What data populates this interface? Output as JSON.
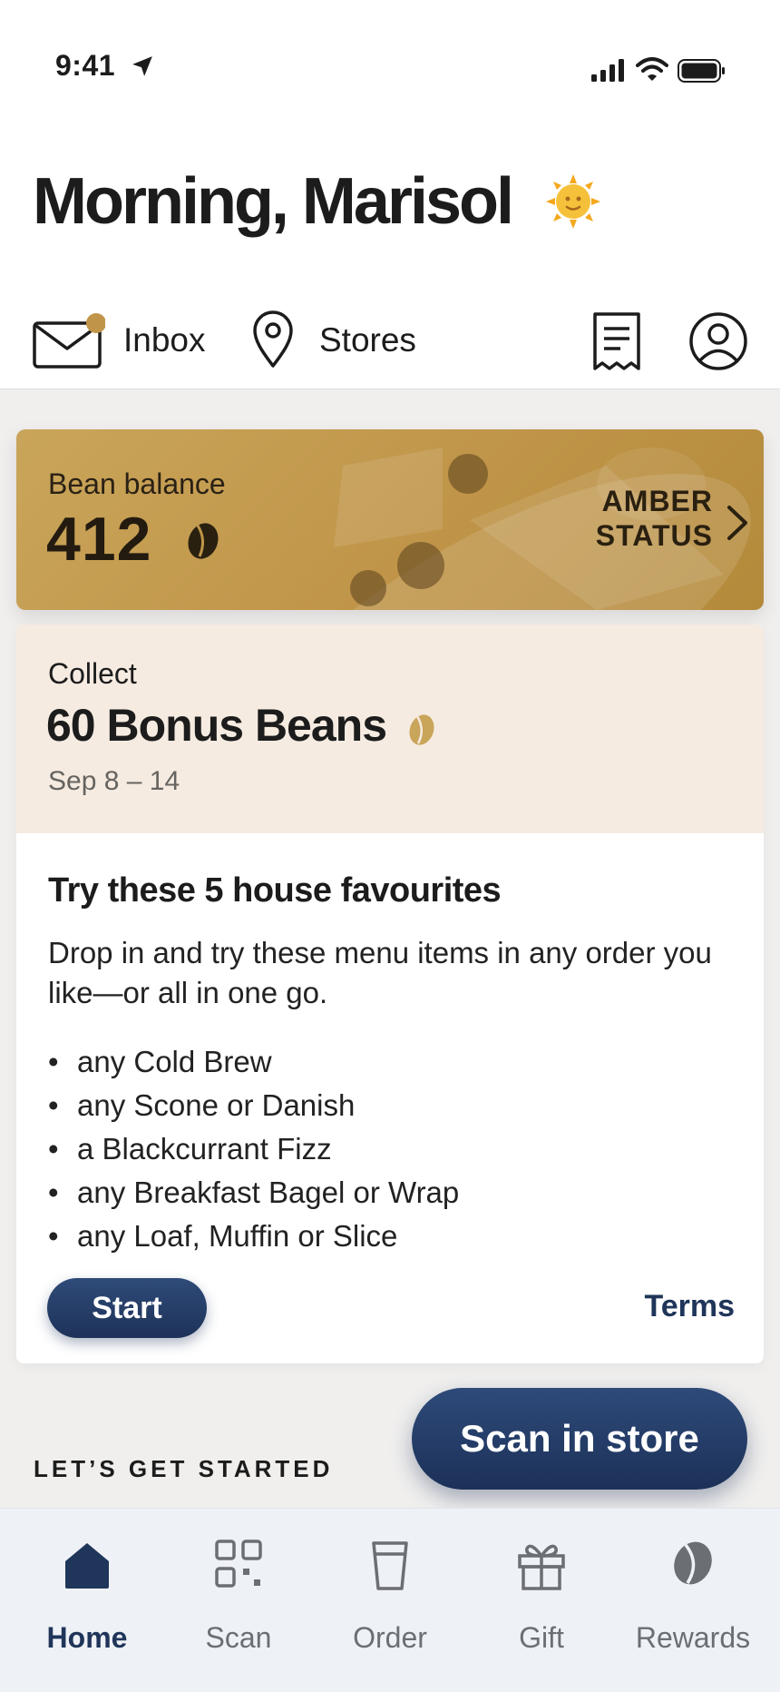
{
  "status_bar": {
    "time": "9:41"
  },
  "header": {
    "greeting": "Morning, Marisol",
    "greeting_icon": "sun-face-icon"
  },
  "top_nav": {
    "inbox_label": "Inbox",
    "stores_label": "Stores",
    "inbox_has_notification": true,
    "accent_color": "#c09549"
  },
  "bean_card": {
    "label": "Bean balance",
    "value": "412",
    "status_line1": "AMBER",
    "status_line2": "STATUS"
  },
  "offer": {
    "collect_label": "Collect",
    "bonus_title": "60 Bonus Beans",
    "dates": "Sep 8 – 14",
    "title": "Try these 5 house favourites",
    "description": "Drop in and try these menu items in any order you like—or all in one go.",
    "items": [
      "any Cold Brew",
      "any Scone or Danish",
      "a Blackcurrant Fizz",
      "any Breakfast Bagel or Wrap",
      "any Loaf, Muffin or Slice"
    ],
    "start_label": "Start",
    "terms_label": "Terms"
  },
  "section": {
    "get_started": "LET’S GET STARTED"
  },
  "scan_in_store_label": "Scan in store",
  "tab_bar": {
    "active": "Home",
    "tabs": [
      {
        "label": "Home",
        "icon": "home-icon"
      },
      {
        "label": "Scan",
        "icon": "scan-icon"
      },
      {
        "label": "Order",
        "icon": "cup-icon"
      },
      {
        "label": "Gift",
        "icon": "gift-icon"
      },
      {
        "label": "Rewards",
        "icon": "bean-icon"
      }
    ]
  },
  "colors": {
    "brand_navy": "#1f3559",
    "gold": "#c09549",
    "offer_header_bg": "#f5ebe1"
  }
}
